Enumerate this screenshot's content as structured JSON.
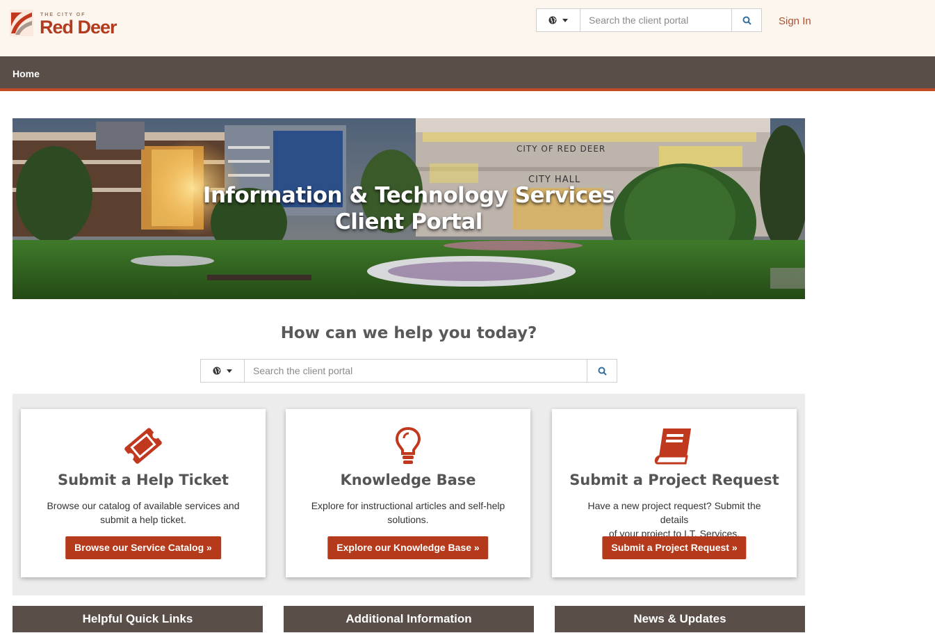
{
  "header": {
    "logo_small": "THE CITY OF",
    "logo_big": "Red Deer",
    "search_placeholder": "Search the client portal",
    "sign_in": "Sign In"
  },
  "nav": {
    "home": "Home"
  },
  "hero": {
    "title_line1": "Information & Technology Services",
    "title_line2": "Client Portal",
    "sign_text": "CITY OF RED DEER",
    "sign_text2": "CITY HALL"
  },
  "help": {
    "heading": "How can we help you today?",
    "search_placeholder": "Search the client portal"
  },
  "cards": [
    {
      "title": "Submit a Help Ticket",
      "desc_line1": "Browse our catalog of available services and",
      "desc_line2": "submit a help ticket.",
      "button": "Browse our Service Catalog »",
      "icon": "ticket-icon"
    },
    {
      "title": "Knowledge Base",
      "desc_line1": "Explore for instructional articles and self-help",
      "desc_line2": "solutions.",
      "button": "Explore our Knowledge Base »",
      "icon": "lightbulb-icon"
    },
    {
      "title": "Submit a Project Request",
      "desc_line1": "Have a new project request? Submit the details",
      "desc_line2": "of your project to I.T. Services.",
      "button": "Submit a Project Request »",
      "icon": "book-icon"
    }
  ],
  "bottom_bars": [
    "Helpful Quick Links",
    "Additional Information",
    "News & Updates"
  ],
  "colors": {
    "accent": "#b43a1b",
    "nav": "#5a4f48",
    "header_bg": "#fdf6ef"
  }
}
